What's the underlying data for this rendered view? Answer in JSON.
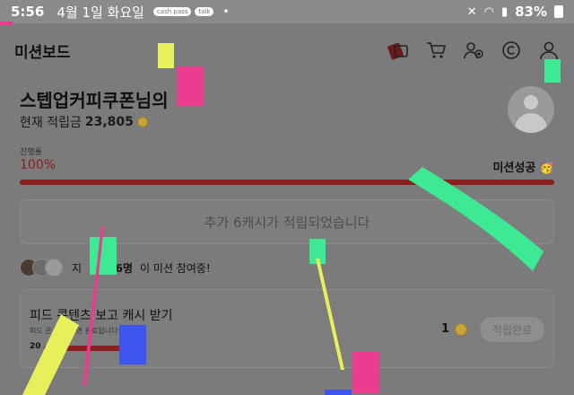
{
  "status_bar": {
    "time": "5:56",
    "date": "4월 1일 화요일",
    "badges": [
      "cash\npass",
      "talk"
    ],
    "dot": "•",
    "battery": "83%"
  },
  "header": {
    "title": "미션보드",
    "icons": [
      "voucher-icon",
      "cart-icon",
      "add-user-icon",
      "coin-c-icon",
      "profile-icon"
    ]
  },
  "user": {
    "greeting": "스텝업커피쿠폰님의",
    "balance_label": "현재 적립금",
    "balance_value": "23,805"
  },
  "progress": {
    "label": "진행률",
    "percent_text": "100%",
    "value": 1.0,
    "success_text": "미션성공 🥳"
  },
  "notice": "추가 6캐시가 적립되었습니다",
  "participants": {
    "prefix": "지",
    "count": "6,186명",
    "suffix": "이 미션 참여중!"
  },
  "mission_card": {
    "title": "피드 콘텐츠 보고 캐시 받기",
    "description": "피드 콘 개를 보면 완료됩니다!",
    "progress_text": "20",
    "reward": "1",
    "button": "적립완료"
  },
  "colors": {
    "accent_red": "#8b1f1f",
    "overlay_green": "#3dea93",
    "overlay_pink": "#ec3b8f",
    "overlay_yellow": "#e6f05a",
    "overlay_blue": "#3d55ee"
  }
}
